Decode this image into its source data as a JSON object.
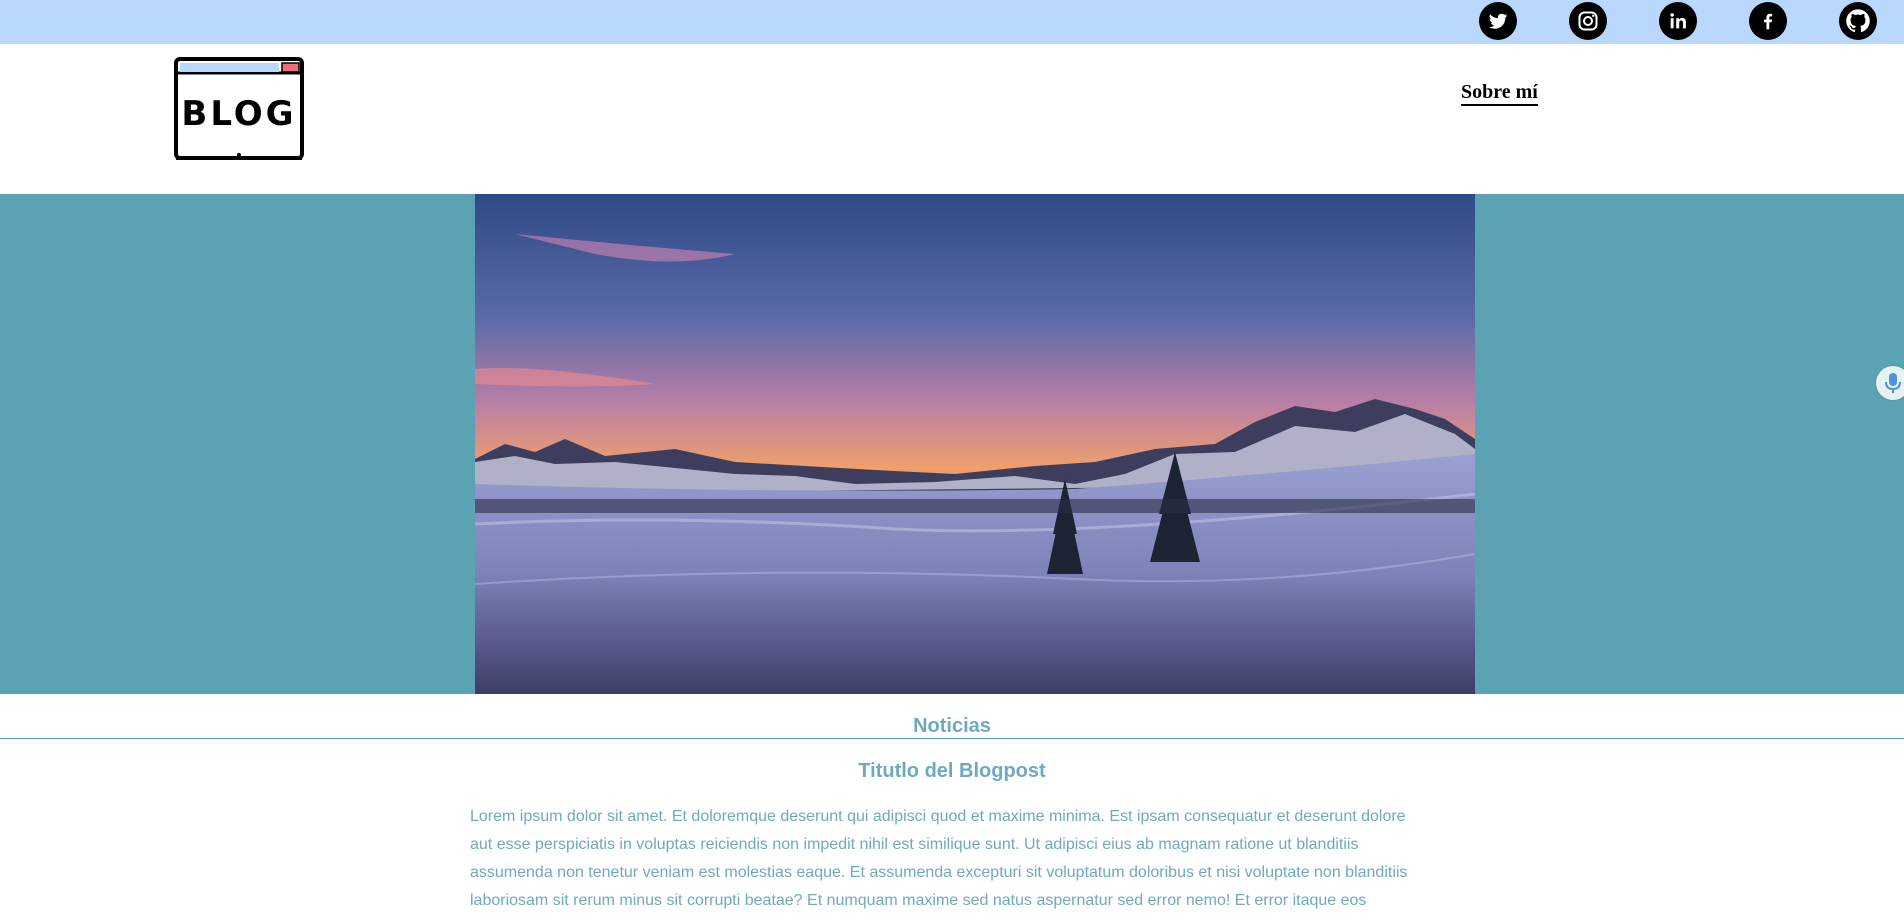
{
  "social": {
    "twitter": "twitter-icon",
    "instagram": "instagram-icon",
    "linkedin": "linkedin-icon",
    "facebook": "facebook-icon",
    "github": "github-icon"
  },
  "header": {
    "logo_text": "BLOG",
    "nav": {
      "about_label": "Sobre mí"
    }
  },
  "hero": {
    "image": "snowy mountain landscape at sunset"
  },
  "section": {
    "title": "Noticias"
  },
  "post": {
    "title": "Titutlo del Blogpost",
    "body": "Lorem ipsum dolor sit amet. Et doloremque deserunt qui adipisci quod et maxime minima. Est ipsam consequatur et deserunt dolore aut esse perspiciatis in voluptas reiciendis non impedit nihil est similique sunt. Ut adipisci eius ab magnam ratione ut blanditiis assumenda non tenetur veniam est molestias eaque. Et assumenda excepturi sit voluptatum doloribus et nisi voluptate non blanditiis laboriosam sit rerum minus sit corrupti beatae? Et numquam maxime sed natus aspernatur sed error nemo! Et error itaque eos"
  },
  "colors": {
    "topbar": "#bad8fe",
    "hero_bg": "#5ba2b3",
    "text_accent": "#6fa9bf"
  }
}
